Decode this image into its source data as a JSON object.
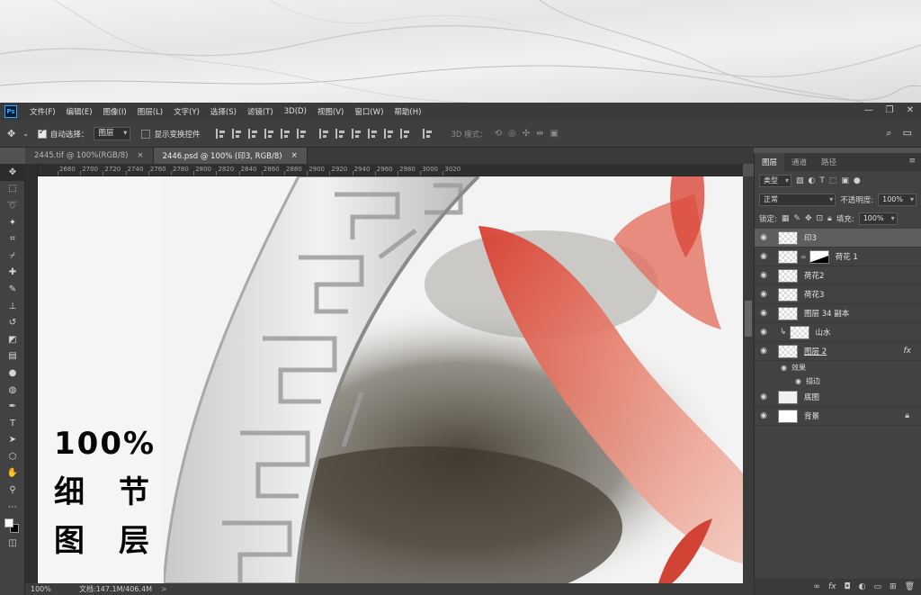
{
  "menu": {
    "items": [
      "文件(F)",
      "编辑(E)",
      "图像(I)",
      "图层(L)",
      "文字(Y)",
      "选择(S)",
      "滤镜(T)",
      "3D(D)",
      "视图(V)",
      "窗口(W)",
      "帮助(H)"
    ],
    "app_logo": "Ps"
  },
  "window_controls": {
    "minimize": "—",
    "restore": "❐",
    "close": "✕"
  },
  "options": {
    "auto_select_label": "自动选择：",
    "auto_select_checked": true,
    "target_value": "图层",
    "show_transform_label": "显示变换控件",
    "show_transform_checked": false,
    "mode_3d_label": "3D 模式："
  },
  "tabs": [
    {
      "label": "2445.tif @ 100%(RGB/8)",
      "close": "×",
      "active": false
    },
    {
      "label": "2446.psd @ 100% (印3, RGB/8)",
      "close": "×",
      "active": true
    }
  ],
  "ruler": {
    "ticks": [
      "2680",
      "2700",
      "2720",
      "2740",
      "2760",
      "2780",
      "2800",
      "2820",
      "2840",
      "2860",
      "2880",
      "2900",
      "2920",
      "2940",
      "2960",
      "2980",
      "3000",
      "3020"
    ]
  },
  "overlay": {
    "line1": "100%",
    "line2": "细节",
    "line3": "图层"
  },
  "status": {
    "zoom": "100%",
    "doc": "文档:147.1M/406.4M",
    "arrow": ">"
  },
  "panel": {
    "tabs": [
      "图层",
      "通道",
      "路径"
    ],
    "active_tab": "图层",
    "kind_filter": "类型",
    "blend_mode": "正常",
    "opacity_label": "不透明度:",
    "opacity_value": "100%",
    "lock_label": "锁定:",
    "fill_label": "填充:",
    "fill_value": "100%",
    "layers": [
      {
        "name": "印3",
        "selected": true,
        "thumb": "transparent"
      },
      {
        "name": "荷花 1",
        "selected": false,
        "thumb": "transparent",
        "mask": true
      },
      {
        "name": "荷花2",
        "selected": false,
        "thumb": "transparent"
      },
      {
        "name": "荷花3",
        "selected": false,
        "thumb": "transparent"
      },
      {
        "name": "图层 34 副本",
        "selected": false,
        "thumb": "transparent"
      },
      {
        "name": "山水",
        "selected": false,
        "thumb": "transparent",
        "clipped": true
      },
      {
        "name": "图层 2",
        "selected": false,
        "thumb": "transparent",
        "fx": "fx"
      },
      {
        "name": "底图",
        "selected": false,
        "thumb": "transparent"
      },
      {
        "name": "背景",
        "selected": false,
        "thumb": "white",
        "locked": true
      }
    ],
    "effects_label": "效果",
    "stroke_label": "描边"
  },
  "colors": {
    "ui_dark": "#3b3b3b",
    "ui_panel": "#424242",
    "canvas_bg": "#535353",
    "selected_layer": "#5e5e5e",
    "accent_blue": "#31a8ff",
    "lotus_red": "#d94a3a"
  }
}
